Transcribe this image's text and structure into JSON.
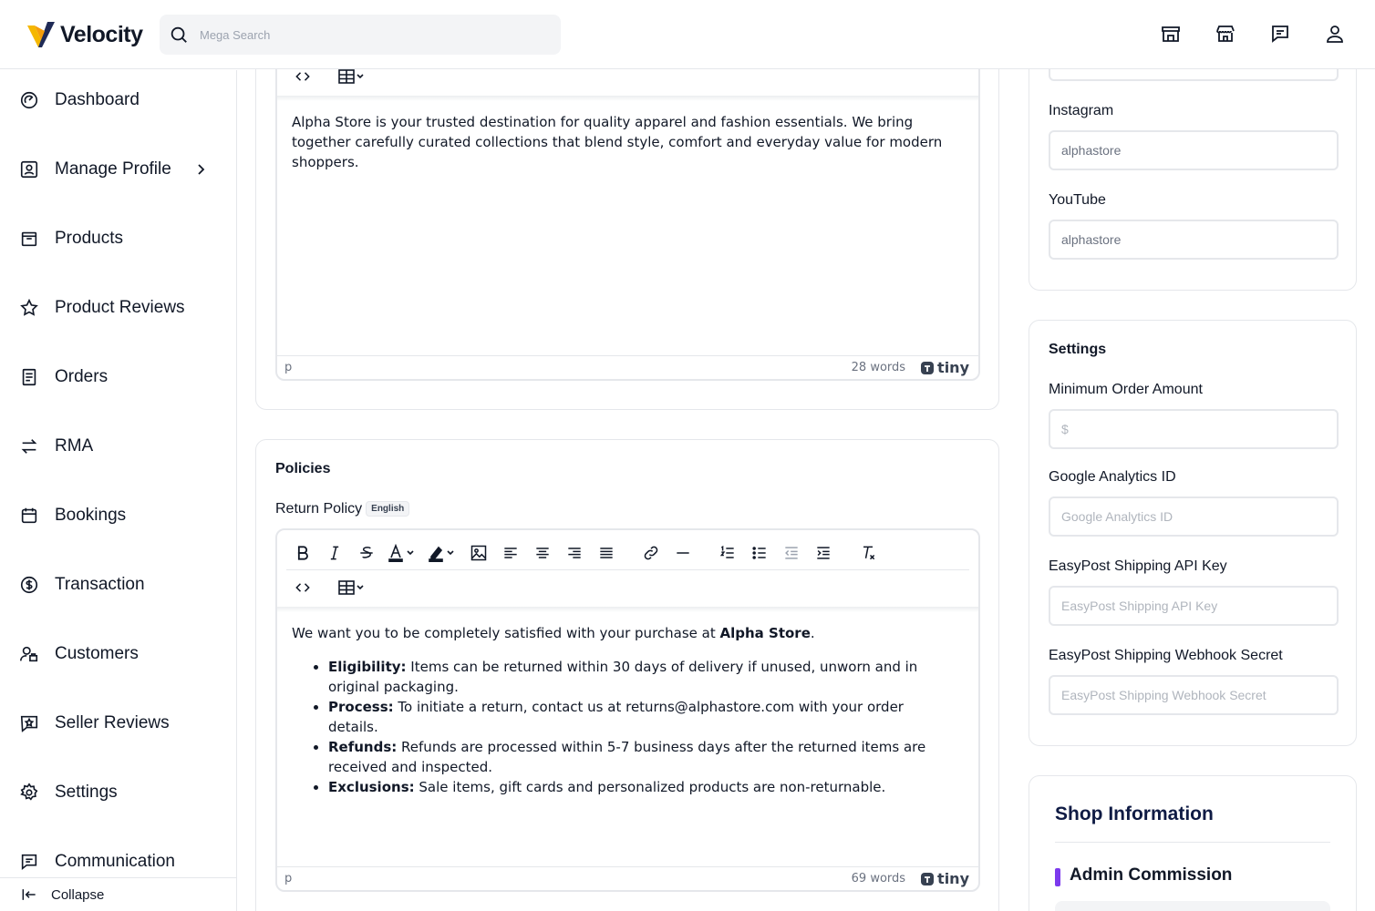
{
  "brand": {
    "name": "Velocity",
    "accent_yellow": "#f5b700",
    "accent_purple": "#7c3aed"
  },
  "search": {
    "placeholder": "Mega Search"
  },
  "header_icons": [
    "store-icon",
    "shop-icon",
    "message-icon",
    "user-icon"
  ],
  "sidebar": {
    "items": [
      {
        "label": "Dashboard",
        "icon": "dashboard-icon"
      },
      {
        "label": "Manage Profile",
        "icon": "profile-icon",
        "has_submenu": true
      },
      {
        "label": "Products",
        "icon": "products-icon"
      },
      {
        "label": "Product Reviews",
        "icon": "star-icon"
      },
      {
        "label": "Orders",
        "icon": "orders-icon"
      },
      {
        "label": "RMA",
        "icon": "swap-icon"
      },
      {
        "label": "Bookings",
        "icon": "calendar-icon"
      },
      {
        "label": "Transaction",
        "icon": "dollar-icon"
      },
      {
        "label": "Customers",
        "icon": "customers-icon"
      },
      {
        "label": "Seller Reviews",
        "icon": "seller-review-icon"
      },
      {
        "label": "Settings",
        "icon": "gear-icon"
      },
      {
        "label": "Communication",
        "icon": "chat-icon"
      }
    ],
    "collapse_label": "Collapse"
  },
  "about_editor": {
    "content": "Alpha Store is your trusted destination for quality apparel and fashion essentials. We bring together carefully curated collections that blend style, comfort and everyday value for modern shoppers.",
    "status_path": "p",
    "word_count": "28 words",
    "brand": "tiny"
  },
  "policies": {
    "title": "Policies",
    "return_policy_label": "Return Policy",
    "language_badge": "English",
    "editor": {
      "intro_prefix": "We want you to be completely satisfied with your purchase at ",
      "intro_store": "Alpha Store",
      "intro_suffix": ".",
      "items": [
        {
          "term": "Eligibility:",
          "text": " Items can be returned within 30 days of delivery if unused, unworn and in original packaging."
        },
        {
          "term": "Process:",
          "text": " To initiate a return, contact us at returns@alphastore.com with your order details."
        },
        {
          "term": "Refunds:",
          "text": " Refunds are processed within 5-7 business days after the returned items are received and inspected."
        },
        {
          "term": "Exclusions:",
          "text": " Sale items, gift cards and personalized products are non-returnable."
        }
      ],
      "status_path": "p",
      "word_count": "69 words",
      "brand": "tiny"
    }
  },
  "social": {
    "instagram": {
      "label": "Instagram",
      "value": "alphastore"
    },
    "youtube": {
      "label": "YouTube",
      "value": "alphastore"
    }
  },
  "settings": {
    "title": "Settings",
    "fields": [
      {
        "label": "Minimum Order Amount",
        "value": "",
        "placeholder": "$"
      },
      {
        "label": "Google Analytics ID",
        "value": "",
        "placeholder": "Google Analytics ID"
      },
      {
        "label": "EasyPost Shipping API Key",
        "value": "",
        "placeholder": "EasyPost Shipping API Key"
      },
      {
        "label": "EasyPost Shipping Webhook Secret",
        "value": "",
        "placeholder": "EasyPost Shipping Webhook Secret"
      }
    ]
  },
  "shop_info": {
    "title": "Shop Information",
    "admin_commission": "Admin Commission"
  }
}
